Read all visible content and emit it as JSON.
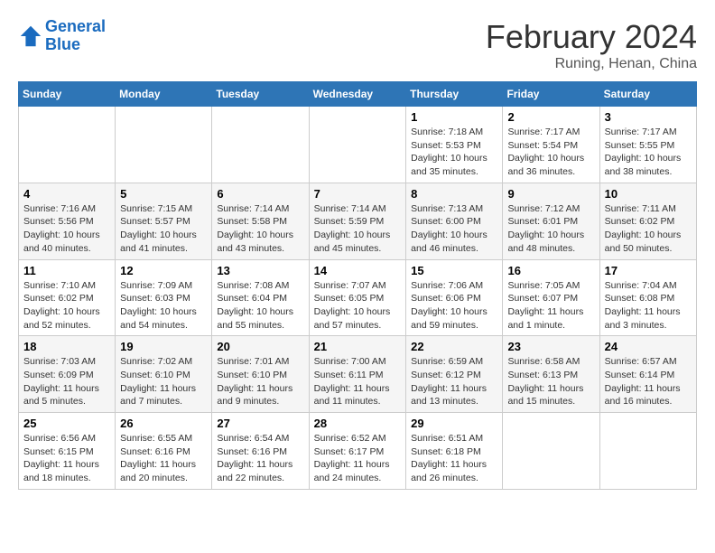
{
  "header": {
    "logo_line1": "General",
    "logo_line2": "Blue",
    "month_year": "February 2024",
    "location": "Runing, Henan, China"
  },
  "days_of_week": [
    "Sunday",
    "Monday",
    "Tuesday",
    "Wednesday",
    "Thursday",
    "Friday",
    "Saturday"
  ],
  "weeks": [
    [
      {
        "day": "",
        "info": ""
      },
      {
        "day": "",
        "info": ""
      },
      {
        "day": "",
        "info": ""
      },
      {
        "day": "",
        "info": ""
      },
      {
        "day": "1",
        "info": "Sunrise: 7:18 AM\nSunset: 5:53 PM\nDaylight: 10 hours and 35 minutes."
      },
      {
        "day": "2",
        "info": "Sunrise: 7:17 AM\nSunset: 5:54 PM\nDaylight: 10 hours and 36 minutes."
      },
      {
        "day": "3",
        "info": "Sunrise: 7:17 AM\nSunset: 5:55 PM\nDaylight: 10 hours and 38 minutes."
      }
    ],
    [
      {
        "day": "4",
        "info": "Sunrise: 7:16 AM\nSunset: 5:56 PM\nDaylight: 10 hours and 40 minutes."
      },
      {
        "day": "5",
        "info": "Sunrise: 7:15 AM\nSunset: 5:57 PM\nDaylight: 10 hours and 41 minutes."
      },
      {
        "day": "6",
        "info": "Sunrise: 7:14 AM\nSunset: 5:58 PM\nDaylight: 10 hours and 43 minutes."
      },
      {
        "day": "7",
        "info": "Sunrise: 7:14 AM\nSunset: 5:59 PM\nDaylight: 10 hours and 45 minutes."
      },
      {
        "day": "8",
        "info": "Sunrise: 7:13 AM\nSunset: 6:00 PM\nDaylight: 10 hours and 46 minutes."
      },
      {
        "day": "9",
        "info": "Sunrise: 7:12 AM\nSunset: 6:01 PM\nDaylight: 10 hours and 48 minutes."
      },
      {
        "day": "10",
        "info": "Sunrise: 7:11 AM\nSunset: 6:02 PM\nDaylight: 10 hours and 50 minutes."
      }
    ],
    [
      {
        "day": "11",
        "info": "Sunrise: 7:10 AM\nSunset: 6:02 PM\nDaylight: 10 hours and 52 minutes."
      },
      {
        "day": "12",
        "info": "Sunrise: 7:09 AM\nSunset: 6:03 PM\nDaylight: 10 hours and 54 minutes."
      },
      {
        "day": "13",
        "info": "Sunrise: 7:08 AM\nSunset: 6:04 PM\nDaylight: 10 hours and 55 minutes."
      },
      {
        "day": "14",
        "info": "Sunrise: 7:07 AM\nSunset: 6:05 PM\nDaylight: 10 hours and 57 minutes."
      },
      {
        "day": "15",
        "info": "Sunrise: 7:06 AM\nSunset: 6:06 PM\nDaylight: 10 hours and 59 minutes."
      },
      {
        "day": "16",
        "info": "Sunrise: 7:05 AM\nSunset: 6:07 PM\nDaylight: 11 hours and 1 minute."
      },
      {
        "day": "17",
        "info": "Sunrise: 7:04 AM\nSunset: 6:08 PM\nDaylight: 11 hours and 3 minutes."
      }
    ],
    [
      {
        "day": "18",
        "info": "Sunrise: 7:03 AM\nSunset: 6:09 PM\nDaylight: 11 hours and 5 minutes."
      },
      {
        "day": "19",
        "info": "Sunrise: 7:02 AM\nSunset: 6:10 PM\nDaylight: 11 hours and 7 minutes."
      },
      {
        "day": "20",
        "info": "Sunrise: 7:01 AM\nSunset: 6:10 PM\nDaylight: 11 hours and 9 minutes."
      },
      {
        "day": "21",
        "info": "Sunrise: 7:00 AM\nSunset: 6:11 PM\nDaylight: 11 hours and 11 minutes."
      },
      {
        "day": "22",
        "info": "Sunrise: 6:59 AM\nSunset: 6:12 PM\nDaylight: 11 hours and 13 minutes."
      },
      {
        "day": "23",
        "info": "Sunrise: 6:58 AM\nSunset: 6:13 PM\nDaylight: 11 hours and 15 minutes."
      },
      {
        "day": "24",
        "info": "Sunrise: 6:57 AM\nSunset: 6:14 PM\nDaylight: 11 hours and 16 minutes."
      }
    ],
    [
      {
        "day": "25",
        "info": "Sunrise: 6:56 AM\nSunset: 6:15 PM\nDaylight: 11 hours and 18 minutes."
      },
      {
        "day": "26",
        "info": "Sunrise: 6:55 AM\nSunset: 6:16 PM\nDaylight: 11 hours and 20 minutes."
      },
      {
        "day": "27",
        "info": "Sunrise: 6:54 AM\nSunset: 6:16 PM\nDaylight: 11 hours and 22 minutes."
      },
      {
        "day": "28",
        "info": "Sunrise: 6:52 AM\nSunset: 6:17 PM\nDaylight: 11 hours and 24 minutes."
      },
      {
        "day": "29",
        "info": "Sunrise: 6:51 AM\nSunset: 6:18 PM\nDaylight: 11 hours and 26 minutes."
      },
      {
        "day": "",
        "info": ""
      },
      {
        "day": "",
        "info": ""
      }
    ]
  ]
}
